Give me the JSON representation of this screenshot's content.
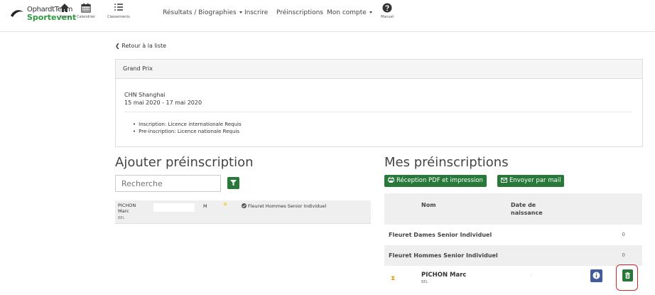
{
  "nav": {
    "brand_line1": "OphardtTeam",
    "brand_line2": "Sportevent",
    "home_label": "Home",
    "calendar_label": "Calendrier",
    "rankings_label": "Classements",
    "menu_results": "Résultats / Biographies",
    "menu_register": "Inscrire",
    "menu_preregistrations": "Préinscriptions",
    "menu_account": "Mon compte",
    "help_label": "Manuel"
  },
  "back_link": "Retour à la liste",
  "competition": {
    "type": "Grand Prix",
    "location": "CHN Shanghai",
    "dates": "15 mai 2020 - 17 mai 2020",
    "licenses": [
      "Inscription: Licence internationale Requis",
      "Pre-inscription: Licence nationale Requis"
    ]
  },
  "add_section": {
    "title": "Ajouter préinscription",
    "search_placeholder": "Recherche",
    "athlete": {
      "last_name": "PICHON",
      "first_name": "Marc",
      "country": "BEL",
      "gender": "M",
      "event": "Fleuret Hommes Senior Individuel"
    }
  },
  "my_section": {
    "title": "Mes préinscriptions",
    "pdf_button": "Réception PDF et impression",
    "mail_button": "Envoyer par mail",
    "col_name": "Nom",
    "col_birth_line1": "Date de",
    "col_birth_line2": "naissance",
    "groups": [
      {
        "name": "Fleuret Dames Senior Individuel",
        "count": "0"
      },
      {
        "name": "Fleuret Hommes Senior Individuel",
        "count": "0"
      }
    ],
    "entry": {
      "name": "PICHON Marc",
      "country": "BEL",
      "birth": ":"
    }
  },
  "colors": {
    "green": "#28783a",
    "info_blue": "#435a9c",
    "highlight_red": "#cc2b2b",
    "brand_green": "#2e9a3e"
  }
}
